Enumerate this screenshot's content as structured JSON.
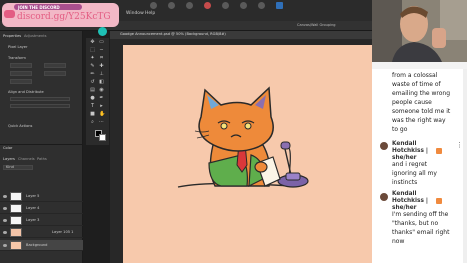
{
  "banner": {
    "join_text": "JOIN THE DISCORD",
    "link_text": "discord.gg/Y25KcTG"
  },
  "menu": [
    "Window",
    "Help"
  ],
  "options_bar": {
    "label": "Canvas/Wall Grouping"
  },
  "properties_panel": {
    "tabs": [
      "Properties",
      "Adjustments"
    ],
    "subtitle": "Pixel Layer",
    "section_transform": "Transform",
    "section_align": "Align and Distribute",
    "section_quick": "Quick Actions"
  },
  "layers_panel": {
    "tabs": [
      "Layers",
      "Channels",
      "Paths"
    ],
    "panel_label": "Color",
    "kind_label": "Kind",
    "layers": [
      {
        "name": "Layer 5"
      },
      {
        "name": "Layer 4"
      },
      {
        "name": "Layer 3"
      },
      {
        "name": "Layer 105 1"
      },
      {
        "name": "Background"
      }
    ]
  },
  "document": {
    "tab_title": "Goodge Announcement.psd @ 50% (Background, RGB/8#)"
  },
  "chat": {
    "messages": [
      {
        "lines": [
          "from a colossal",
          "waste of time of",
          "emailing the wrong",
          "people cause",
          "someone told me it",
          "was the right way",
          "to go"
        ]
      },
      {
        "author": [
          "Kendall",
          "Hotchkiss |",
          "she/her"
        ],
        "lines": [
          "and i regret",
          "ignoring all my",
          "instincts"
        ]
      },
      {
        "author": [
          "Kendall",
          "Hotchkiss |",
          "she/her"
        ],
        "lines": [
          "I'm sending off the",
          "\"thanks, but no",
          "thanks\" email right",
          "now"
        ]
      }
    ]
  },
  "colors": {
    "artboard": "#f7c9ac",
    "accent_teal": "#1ec0b5",
    "discord_pink": "#e35d83"
  }
}
